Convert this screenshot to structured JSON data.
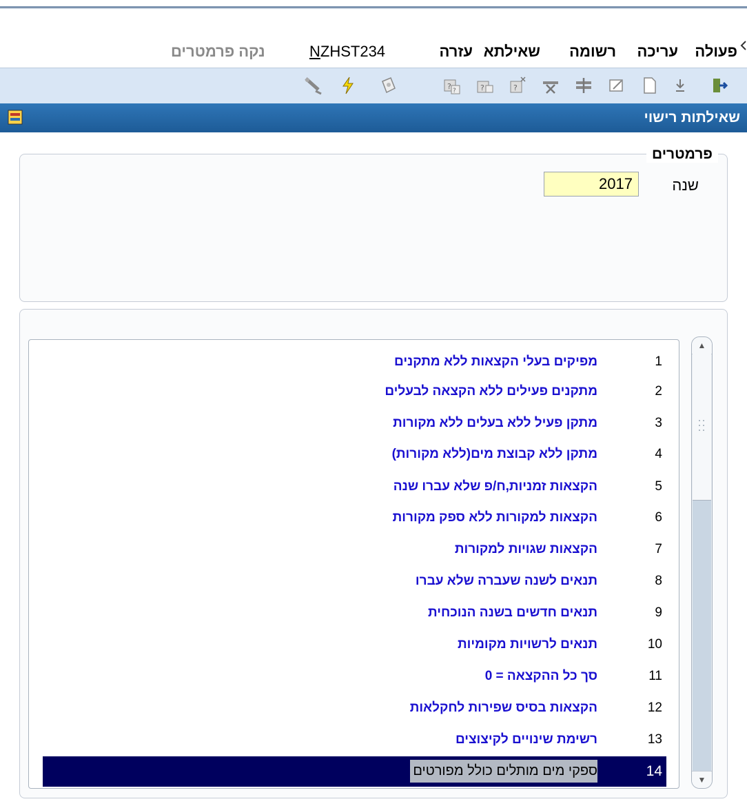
{
  "menu": {
    "items": [
      "פעולה",
      "עריכה",
      "רשומה",
      "שאילתא",
      "עזרה"
    ],
    "form_name_underlined": "N",
    "form_name_rest": "ZHST234",
    "clear_params": "נקה פרמטרים"
  },
  "toolbar": {
    "icons": [
      "exit-icon",
      "download-icon",
      "new-record-icon",
      "edit-icon",
      "insert-row-icon",
      "delete-row-icon",
      "query-delete-icon",
      "query-icon",
      "query-run-icon",
      "save-icon",
      "lightning-icon",
      "tools-icon"
    ]
  },
  "window": {
    "title": "שאילתות רישוי"
  },
  "params": {
    "legend": "פרמטרים",
    "year_label": "שנה",
    "year_value": "2017"
  },
  "list": {
    "items": [
      {
        "num": "1",
        "text": "מפיקים בעלי הקצאות ללא מתקנים"
      },
      {
        "num": "2",
        "text": "מתקנים פעילים ללא הקצאה לבעלים"
      },
      {
        "num": "3",
        "text": "מתקן פעיל ללא בעלים ללא מקורות"
      },
      {
        "num": "4",
        "text": "מתקן ללא קבוצת מים(ללא מקורות)"
      },
      {
        "num": "5",
        "text": "הקצאות זמניות,ח/פ שלא עברו שנה"
      },
      {
        "num": "6",
        "text": "הקצאות למקורות ללא ספק מקורות"
      },
      {
        "num": "7",
        "text": "הקצאות שגויות למקורות"
      },
      {
        "num": "8",
        "text": "תנאים לשנה שעברה שלא עברו"
      },
      {
        "num": "9",
        "text": "תנאים חדשים בשנה הנוכחית"
      },
      {
        "num": "10",
        "text": "תנאים לרשויות מקומיות"
      },
      {
        "num": "11",
        "text": "סך כל ההקצאה = 0"
      },
      {
        "num": "12",
        "text": "הקצאות בסיס שפירות לחקלאות"
      },
      {
        "num": "13",
        "text": "רשימת שינויים לקיצוצים"
      },
      {
        "num": "14",
        "text": "ספקי מים מותלים כולל מפורטים"
      }
    ],
    "selected_index": 14
  },
  "colors": {
    "titlebar": "#1d5b97",
    "list_text": "#1a10d0",
    "selection": "#00005e",
    "year_field": "#ffffc0"
  }
}
